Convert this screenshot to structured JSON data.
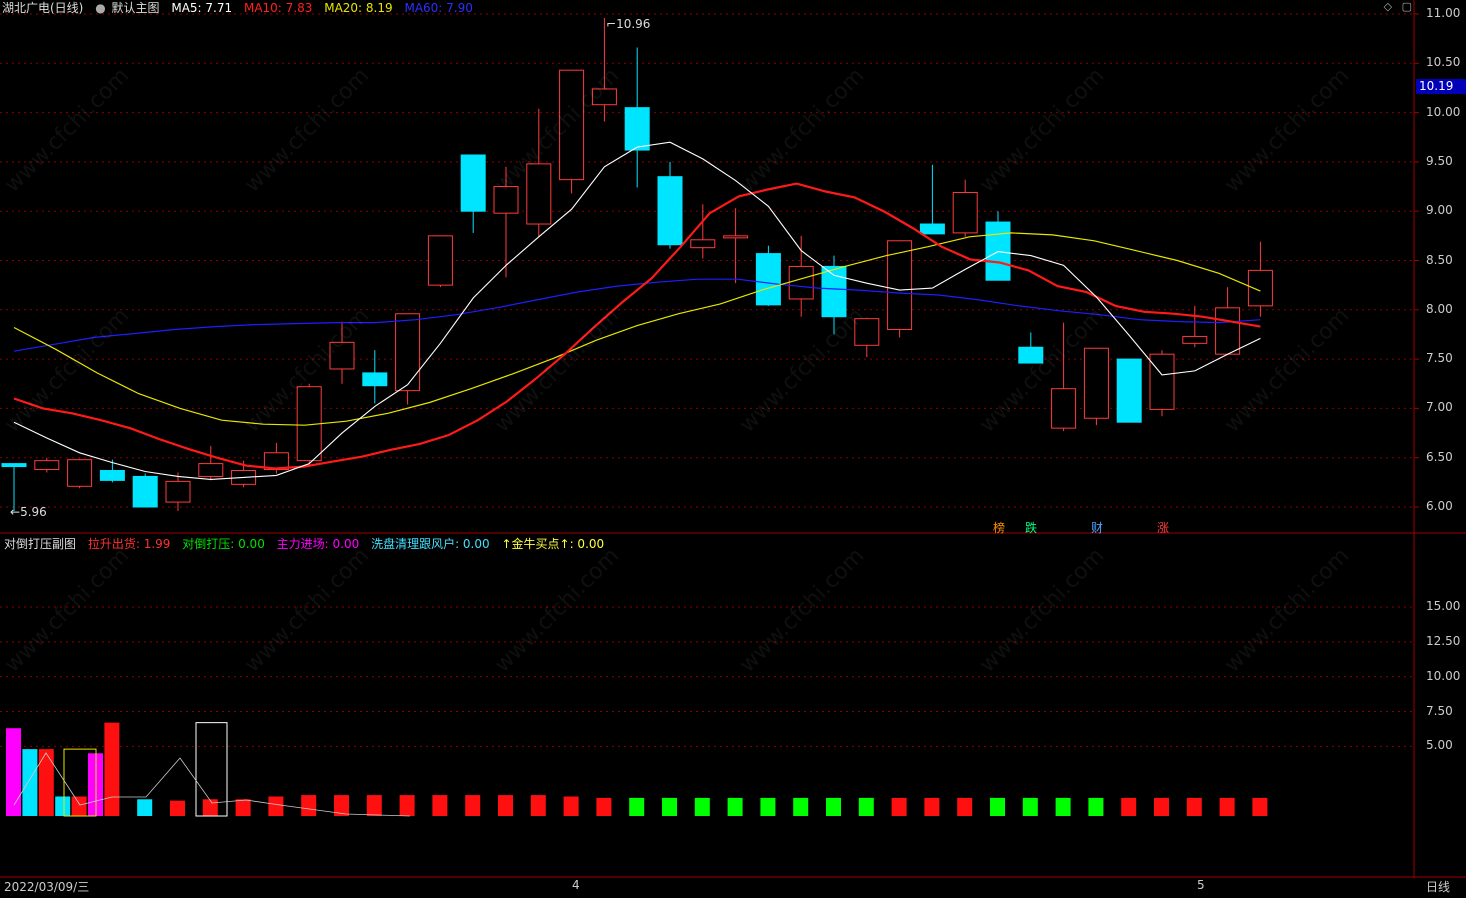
{
  "main_header": {
    "title": "湖北广电(日线)",
    "chart_name": "默认主图",
    "ma5": "MA5: 7.71",
    "ma10": "MA10: 7.83",
    "ma20": "MA20: 8.19",
    "ma60": "MA60: 7.90"
  },
  "sub_header": {
    "title": "对倒打压副图",
    "items": [
      "拉升出货: 1.99",
      "对倒打压: 0.00",
      "主力进场: 0.00",
      "洗盘清理跟风户: 0.00",
      "↑金牛买点↑: 0.00"
    ]
  },
  "colors": {
    "up": "#ff3b3b",
    "down": "#00e5ff",
    "ma5": "#ffffff",
    "ma10": "#ff1a1a",
    "ma20": "#e6e600",
    "ma60": "#1e1eff",
    "grid": "#8b0000",
    "sub_green": "#00ff00",
    "sub_magenta": "#ff00ff"
  },
  "price_axis": [
    "11.00",
    "10.50",
    "10.00",
    "9.50",
    "9.00",
    "8.50",
    "8.00",
    "7.50",
    "7.00",
    "6.50",
    "6.00"
  ],
  "current_price": "10.19",
  "high_label": "10.96",
  "low_label": "5.96",
  "sub_axis": [
    "15.00",
    "12.50",
    "10.00",
    "7.50",
    "5.00"
  ],
  "date_label": "2022/03/09/三",
  "month_markers": [
    "4",
    "5"
  ],
  "period_label": "日线",
  "signals": [
    "榜",
    "跌",
    "财",
    "涨"
  ],
  "watermark": "www.cfchi.com",
  "corner_icons": [
    "diamond-icon",
    "window-icon"
  ],
  "chart_data": {
    "type": "candlestick",
    "ylim": [
      5.8,
      11.1
    ],
    "candles": [
      {
        "o": 6.44,
        "h": 6.44,
        "l": 5.96,
        "c": 6.41
      },
      {
        "o": 6.38,
        "h": 6.5,
        "l": 6.35,
        "c": 6.47
      },
      {
        "o": 6.21,
        "h": 6.49,
        "l": 6.19,
        "c": 6.48
      },
      {
        "o": 6.37,
        "h": 6.48,
        "l": 6.25,
        "c": 6.27
      },
      {
        "o": 6.31,
        "h": 6.34,
        "l": 6.0,
        "c": 6.0
      },
      {
        "o": 6.05,
        "h": 6.35,
        "l": 5.96,
        "c": 6.26
      },
      {
        "o": 6.31,
        "h": 6.62,
        "l": 6.27,
        "c": 6.44
      },
      {
        "o": 6.23,
        "h": 6.47,
        "l": 6.2,
        "c": 6.37
      },
      {
        "o": 6.38,
        "h": 6.65,
        "l": 6.34,
        "c": 6.55
      },
      {
        "o": 6.47,
        "h": 7.25,
        "l": 6.43,
        "c": 7.22
      },
      {
        "o": 7.4,
        "h": 7.88,
        "l": 7.25,
        "c": 7.67
      },
      {
        "o": 7.36,
        "h": 7.59,
        "l": 7.05,
        "c": 7.23
      },
      {
        "o": 7.18,
        "h": 7.94,
        "l": 7.04,
        "c": 7.96
      },
      {
        "o": 8.25,
        "h": 8.75,
        "l": 8.23,
        "c": 8.75
      },
      {
        "o": 9.57,
        "h": 9.57,
        "l": 8.78,
        "c": 9.0
      },
      {
        "o": 8.98,
        "h": 9.45,
        "l": 8.33,
        "c": 9.25
      },
      {
        "o": 8.87,
        "h": 10.04,
        "l": 8.74,
        "c": 9.48
      },
      {
        "o": 9.32,
        "h": 10.43,
        "l": 9.18,
        "c": 10.43
      },
      {
        "o": 10.08,
        "h": 10.96,
        "l": 9.91,
        "c": 10.24
      },
      {
        "o": 10.05,
        "h": 10.66,
        "l": 9.24,
        "c": 9.62
      },
      {
        "o": 9.35,
        "h": 9.5,
        "l": 8.62,
        "c": 8.66
      },
      {
        "o": 8.63,
        "h": 9.07,
        "l": 8.52,
        "c": 8.71
      },
      {
        "o": 8.73,
        "h": 9.03,
        "l": 8.27,
        "c": 8.75
      },
      {
        "o": 8.57,
        "h": 8.65,
        "l": 8.04,
        "c": 8.05
      },
      {
        "o": 8.11,
        "h": 8.75,
        "l": 7.93,
        "c": 8.44
      },
      {
        "o": 8.44,
        "h": 8.55,
        "l": 7.75,
        "c": 7.93
      },
      {
        "o": 7.64,
        "h": 7.92,
        "l": 7.52,
        "c": 7.91
      },
      {
        "o": 7.8,
        "h": 8.7,
        "l": 7.72,
        "c": 8.7
      },
      {
        "o": 8.87,
        "h": 9.47,
        "l": 8.77,
        "c": 8.77
      },
      {
        "o": 8.78,
        "h": 9.32,
        "l": 8.74,
        "c": 9.19
      },
      {
        "o": 8.89,
        "h": 9.0,
        "l": 8.3,
        "c": 8.3
      },
      {
        "o": 7.62,
        "h": 7.77,
        "l": 7.46,
        "c": 7.46
      },
      {
        "o": 6.8,
        "h": 7.87,
        "l": 6.77,
        "c": 7.2
      },
      {
        "o": 6.9,
        "h": 7.61,
        "l": 6.83,
        "c": 7.61
      },
      {
        "o": 7.5,
        "h": 7.5,
        "l": 6.86,
        "c": 6.86
      },
      {
        "o": 6.99,
        "h": 7.59,
        "l": 6.92,
        "c": 7.55
      },
      {
        "o": 7.66,
        "h": 8.04,
        "l": 7.62,
        "c": 7.73
      },
      {
        "o": 7.55,
        "h": 8.23,
        "l": 7.54,
        "c": 8.02
      },
      {
        "o": 8.04,
        "h": 8.69,
        "l": 7.93,
        "c": 8.4
      }
    ],
    "ma5": [
      6.86,
      6.7,
      6.55,
      6.45,
      6.36,
      6.31,
      6.28,
      6.3,
      6.32,
      6.44,
      6.75,
      7.02,
      7.24,
      7.66,
      8.12,
      8.45,
      8.74,
      9.02,
      9.45,
      9.65,
      9.7,
      9.53,
      9.31,
      9.05,
      8.6,
      8.35,
      8.27,
      8.2,
      8.22,
      8.41,
      8.59,
      8.55,
      8.45,
      8.13,
      7.74,
      7.34,
      7.38,
      7.55,
      7.71
    ],
    "ma10": [
      7.1,
      7.0,
      6.95,
      6.88,
      6.8,
      6.69,
      6.59,
      6.5,
      6.42,
      6.39,
      6.41,
      6.46,
      6.51,
      6.58,
      6.64,
      6.73,
      6.88,
      7.07,
      7.3,
      7.55,
      7.82,
      8.08,
      8.32,
      8.64,
      8.98,
      9.15,
      9.22,
      9.28,
      9.2,
      9.14,
      9.0,
      8.83,
      8.64,
      8.51,
      8.48,
      8.4,
      8.24,
      8.18,
      8.04,
      7.98,
      7.96,
      7.93,
      7.88,
      7.83
    ],
    "ma20": [
      7.82,
      7.6,
      7.36,
      7.15,
      7.0,
      6.88,
      6.84,
      6.83,
      6.87,
      6.95,
      7.06,
      7.2,
      7.35,
      7.51,
      7.69,
      7.84,
      7.96,
      8.06,
      8.2,
      8.32,
      8.44,
      8.55,
      8.64,
      8.74,
      8.78,
      8.76,
      8.7,
      8.6,
      8.5,
      8.37,
      8.19
    ],
    "ma60": [
      7.58,
      7.65,
      7.72,
      7.76,
      7.8,
      7.83,
      7.85,
      7.86,
      7.87,
      7.87,
      7.9,
      7.95,
      8.02,
      8.1,
      8.18,
      8.24,
      8.28,
      8.31,
      8.31,
      8.26,
      8.22,
      8.2,
      8.17,
      8.15,
      8.1,
      8.04,
      7.99,
      7.95,
      7.9,
      7.88,
      7.87,
      7.9
    ],
    "sub_values": [
      6.3,
      4.8,
      4.8,
      1.4,
      1.4,
      4.5,
      6.7,
      1.4,
      1.2,
      1.1,
      1.1,
      1.2,
      1.2,
      1.2,
      1.2,
      1.3,
      1.4,
      1.4,
      1.5,
      1.5,
      1.5,
      1.5,
      1.5,
      1.5,
      1.5,
      1.5,
      1.5,
      1.4,
      1.5,
      1.4,
      1.5,
      1.5,
      1.5,
      1.4,
      1.4,
      1.4,
      1.3,
      1.2,
      1.3,
      1.3,
      1.3,
      1.3,
      1.3,
      1.3,
      1.3,
      1.3,
      1.3,
      1.3,
      1.3,
      1.3,
      1.3,
      1.3,
      1.3,
      1.3,
      1.3,
      1.3,
      1.3,
      1.3,
      1.3,
      1.3,
      1.3,
      1.3,
      1.3,
      1.3,
      1.3,
      1.3,
      1.3,
      1.3,
      1.3,
      1.3,
      1.3,
      1.3,
      1.3,
      1.3,
      1.3,
      1.3,
      1.3,
      1.3,
      1.3,
      1.3
    ]
  }
}
